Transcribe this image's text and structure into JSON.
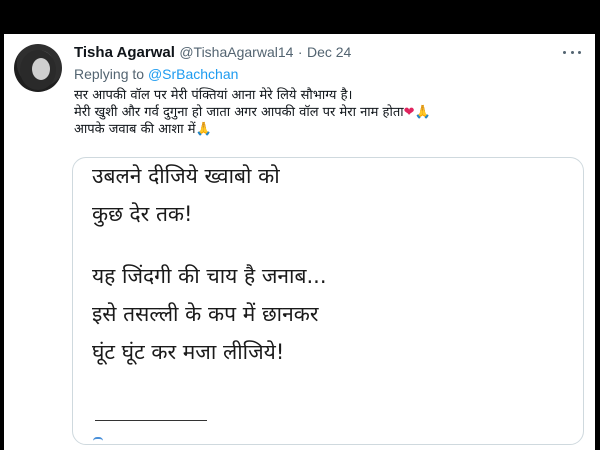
{
  "tweet": {
    "author_name": "Tisha Agarwal",
    "handle": "@TishaAgarwal14",
    "separator": "·",
    "date": "Dec 24",
    "replying_to_label": "Replying to",
    "replying_to_mention": "@SrBachchan",
    "lines": [
      "सर आपकी वॉल पर मेरी पंक्तियां आना मेरे लिये सौभाग्य है।",
      "मेरी खुशी और गर्व दुगुना हो जाता अगर आपकी वॉल पर मेरा नाम होता",
      "आपके जवाब की आशा में"
    ],
    "emoji_heart": "❤",
    "emoji_pray": "🙏"
  },
  "card": {
    "lines": [
      "उबलने दीजिये ख्वाबो को",
      "कुछ देर तक!",
      "यह जिंदगी की चाय है जनाब...",
      "इसे तसल्ली के कप में छानकर",
      "घूंट घूंट कर मजा लीजिये!"
    ]
  },
  "icons": {
    "more": "more-options-icon",
    "avatar": "profile-avatar"
  },
  "colors": {
    "link": "#1d9bf0",
    "secondary_text": "#536471",
    "primary_text": "#0f1419",
    "heart": "#e0245e"
  }
}
